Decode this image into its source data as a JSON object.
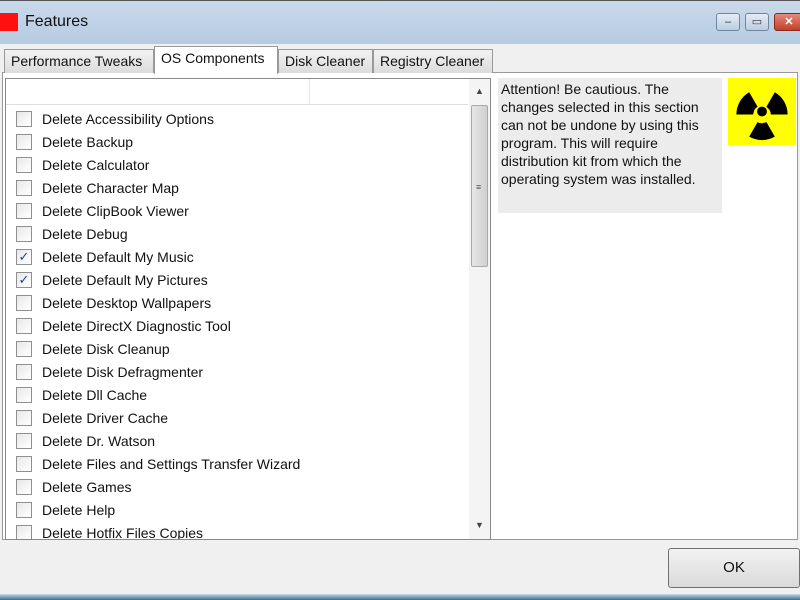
{
  "window": {
    "title": "Features",
    "minimize": "‒",
    "maximize": "▭",
    "close": "✕"
  },
  "tabs": [
    {
      "label": "Performance Tweaks"
    },
    {
      "label": "OS Components",
      "active": true
    },
    {
      "label": "Disk Cleaner"
    },
    {
      "label": "Registry Cleaner"
    }
  ],
  "items": [
    {
      "label": "Delete Accessibility Options",
      "checked": false
    },
    {
      "label": "Delete Backup",
      "checked": false
    },
    {
      "label": "Delete Calculator",
      "checked": false
    },
    {
      "label": "Delete Character Map",
      "checked": false
    },
    {
      "label": "Delete ClipBook Viewer",
      "checked": false
    },
    {
      "label": "Delete Debug",
      "checked": false
    },
    {
      "label": "Delete Default My Music",
      "checked": true
    },
    {
      "label": "Delete Default My Pictures",
      "checked": true
    },
    {
      "label": "Delete Desktop Wallpapers",
      "checked": false
    },
    {
      "label": "Delete DirectX Diagnostic Tool",
      "checked": false
    },
    {
      "label": "Delete Disk Cleanup",
      "checked": false
    },
    {
      "label": "Delete Disk Defragmenter",
      "checked": false
    },
    {
      "label": "Delete Dll Cache",
      "checked": false
    },
    {
      "label": "Delete Driver Cache",
      "checked": false
    },
    {
      "label": "Delete Dr. Watson",
      "checked": false
    },
    {
      "label": "Delete Files and Settings Transfer Wizard",
      "checked": false
    },
    {
      "label": "Delete Games",
      "checked": false
    },
    {
      "label": "Delete Help",
      "checked": false
    },
    {
      "label": "Delete Hotfix Files Copies",
      "checked": false
    }
  ],
  "warning": "Attention! Be cautious. The changes selected in this section can not be undone by using this program. This will require distribution kit from which the operating system was installed.",
  "warning_icon": "radiation-icon",
  "colors": {
    "warning_icon_bg": "#ffff00"
  },
  "ok_label": "OK"
}
